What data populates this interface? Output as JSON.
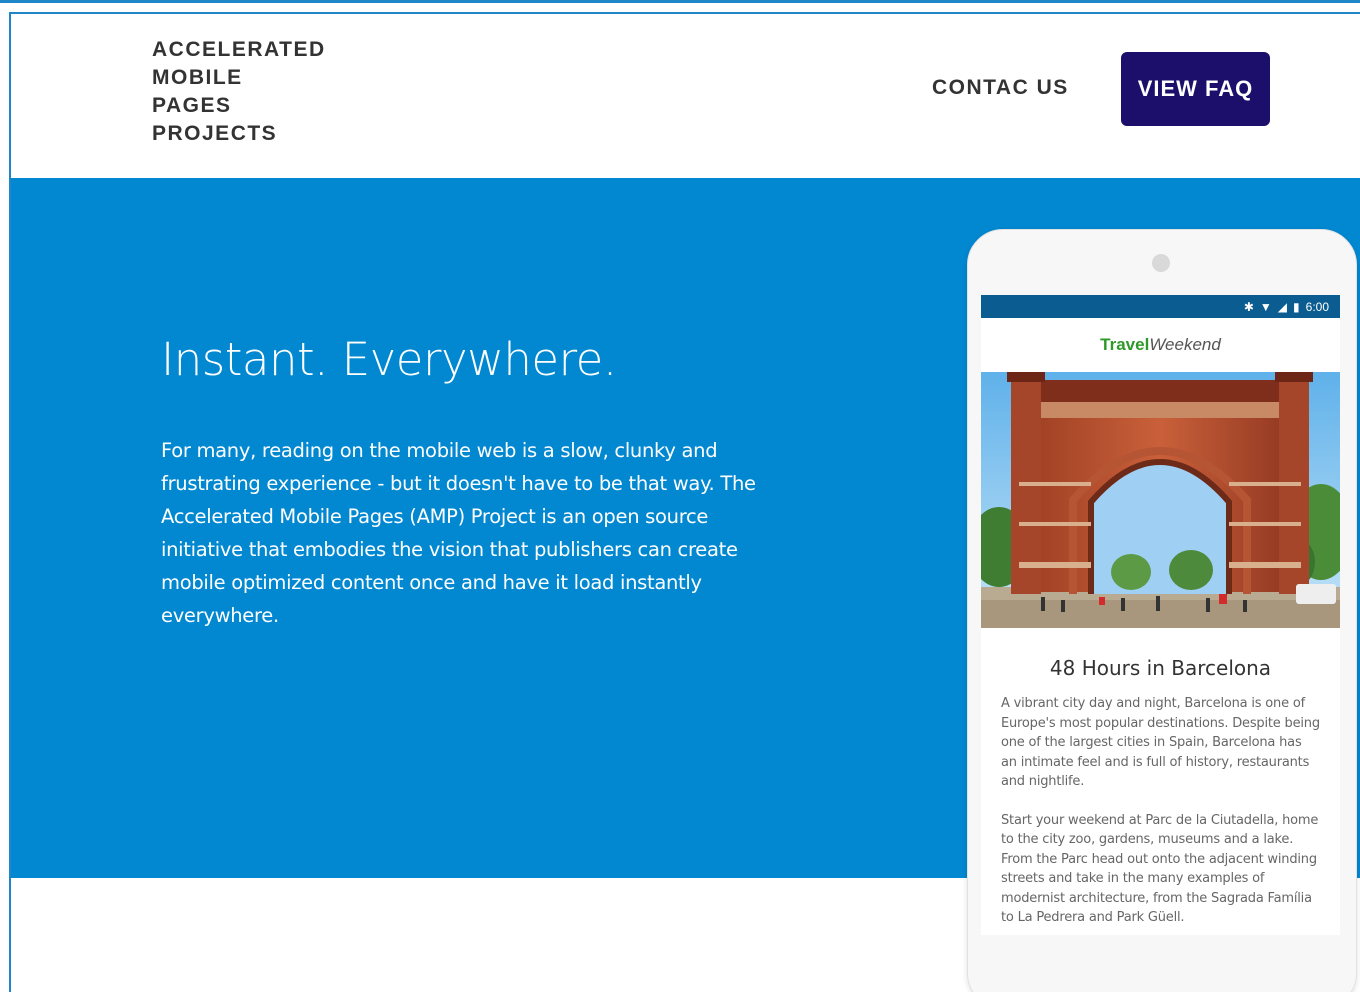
{
  "header": {
    "logo_lines": [
      "ACCELERATED",
      "MOBILE",
      "PAGES",
      "PROJECTS"
    ],
    "contact_label": "CONTAC US",
    "faq_label": "VIEW FAQ"
  },
  "hero": {
    "title": "Instant. Everywhere.",
    "text": "For many, reading on the mobile web is a slow, clunky and frustrating experience - but it doesn't have to be that way. The Accelerated Mobile Pages (AMP) Project is an open source initiative that embodies the vision that publishers can create mobile optimized content once and have it load instantly everywhere."
  },
  "phone": {
    "status_time": "6:00",
    "brand_travel": "Travel",
    "brand_weekend": "Weekend",
    "article_title": "48 Hours in Barcelona",
    "paragraph_1": "A vibrant city day and night, Barcelona is one of Europe's most popular destinations. Despite being one of the largest cities in Spain, Barcelona has an intimate feel and is full of history, restaurants and nightlife.",
    "paragraph_2": "Start your weekend at Parc de la Ciutadella, home to the city zoo, gardens, museums and a lake. From the Parc head out onto the adjacent winding streets and take in the many examples of modernist architecture, from the Sagrada Família to La Pedrera and Park Güell."
  },
  "colors": {
    "hero_bg": "#0288d1",
    "faq_button_bg": "#1b0f6b",
    "brand_green": "#2e9a2a"
  }
}
